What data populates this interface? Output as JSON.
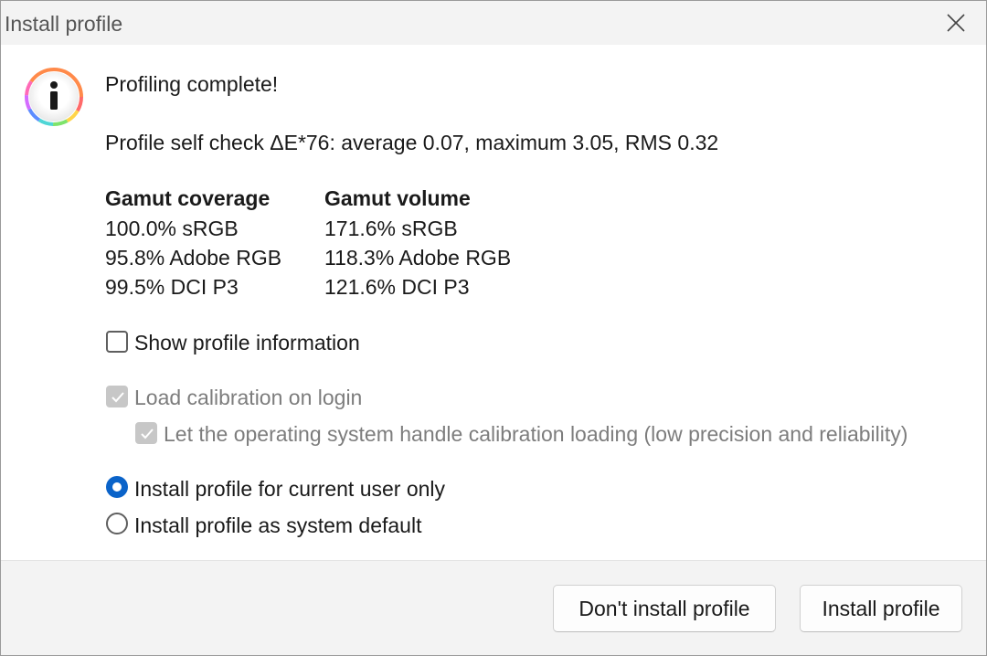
{
  "window": {
    "title": "Install profile"
  },
  "icons": {
    "close": "close-icon",
    "info": "info-icon"
  },
  "message": {
    "heading": "Profiling complete!",
    "self_check": "Profile self check ΔE*76: average 0.07, maximum 3.05, RMS 0.32"
  },
  "gamut": {
    "coverage_header": "Gamut coverage",
    "volume_header": "Gamut volume",
    "coverage": [
      "100.0% sRGB",
      "95.8% Adobe RGB",
      "99.5% DCI P3"
    ],
    "volume": [
      "171.6% sRGB",
      "118.3% Adobe RGB",
      "121.6% DCI P3"
    ]
  },
  "options": {
    "show_info": {
      "label": "Show profile information",
      "checked": false
    },
    "load_calibration": {
      "label": "Load calibration on login",
      "checked": true,
      "disabled": true
    },
    "os_handle": {
      "label": "Let the operating system handle calibration loading (low precision and reliability)",
      "checked": true,
      "disabled": true
    },
    "current_user": {
      "label": "Install profile for current user only",
      "selected": true
    },
    "system_default": {
      "label": "Install profile as system default",
      "selected": false
    }
  },
  "buttons": {
    "dont_install": "Don't install profile",
    "install": "Install profile"
  },
  "colors": {
    "accent": "#0a63c9",
    "titlebar": "#f3f3f3",
    "disabled_text": "#7d7d7d"
  }
}
